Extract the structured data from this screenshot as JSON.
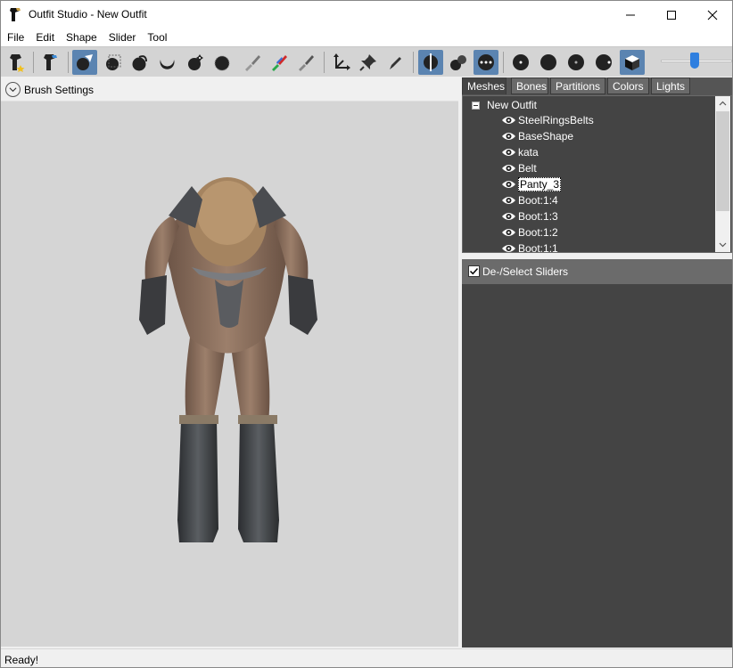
{
  "window": {
    "title": "Outfit Studio - New Outfit",
    "minimize_icon": "minimize-icon",
    "maximize_icon": "maximize-icon",
    "close_icon": "close-icon"
  },
  "menu": [
    "File",
    "Edit",
    "Shape",
    "Slider",
    "Tool"
  ],
  "toolbar": {
    "tools": [
      {
        "name": "new-slider-button",
        "icon": "slider-star-icon",
        "active": false
      },
      {
        "name": "slider-edit-button",
        "icon": "slider-edit-icon",
        "active": false
      },
      {
        "name": "select-tool-button",
        "icon": "arrow-select-icon",
        "active": true
      },
      {
        "name": "transform-tool-button",
        "icon": "box-select-icon",
        "active": false
      },
      {
        "name": "inflate-brush-button",
        "icon": "inflate-brush-icon",
        "active": false
      },
      {
        "name": "deflate-brush-button",
        "icon": "deflate-brush-icon",
        "active": false
      },
      {
        "name": "move-brush-button",
        "icon": "move-brush-icon",
        "active": false
      },
      {
        "name": "smooth-brush-button",
        "icon": "smooth-brush-icon",
        "active": false
      },
      {
        "name": "mask-brush-button",
        "icon": "mask-brush-icon",
        "active": false
      },
      {
        "name": "weight-brush-button",
        "icon": "weight-brush-icon",
        "active": false
      },
      {
        "name": "color-brush-button",
        "icon": "color-brush-icon",
        "active": false
      },
      {
        "name": "axis-tool-button",
        "icon": "axis-icon",
        "active": false
      },
      {
        "name": "pin-tool-button",
        "icon": "pin-icon",
        "active": false
      },
      {
        "name": "pencil-tool-button",
        "icon": "pencil-icon",
        "active": false
      },
      {
        "name": "mirror-x-button",
        "icon": "mirror-icon",
        "active": true
      },
      {
        "name": "connected-only-button",
        "icon": "connected-icon",
        "active": false
      },
      {
        "name": "global-brush-button",
        "icon": "dots-icon",
        "active": true
      },
      {
        "name": "show-vertices-button",
        "icon": "vertices-icon",
        "active": false
      },
      {
        "name": "wireframe-button",
        "icon": "wireframe-icon",
        "active": false
      },
      {
        "name": "lighting-button",
        "icon": "lighting-icon",
        "active": false
      },
      {
        "name": "texture-button",
        "icon": "texture-icon",
        "active": false
      },
      {
        "name": "cube-view-button",
        "icon": "cube-icon",
        "active": true
      }
    ],
    "brush_size_level": 0.45
  },
  "brush_settings": {
    "label": "Brush Settings"
  },
  "tabs": [
    "Meshes",
    "Bones",
    "Partitions",
    "Colors",
    "Lights"
  ],
  "mesh_tree": {
    "root": "New Outfit",
    "items": [
      "SteelRingsBelts",
      "BaseShape",
      "kata",
      "Belt",
      "Panty_3",
      "Boot:1:4",
      "Boot:1:3",
      "Boot:1:2",
      "Boot:1:1"
    ],
    "selected": "Panty_3"
  },
  "sliders": {
    "toggle_label": "De-/Select Sliders",
    "checked": true
  },
  "status": "Ready!"
}
